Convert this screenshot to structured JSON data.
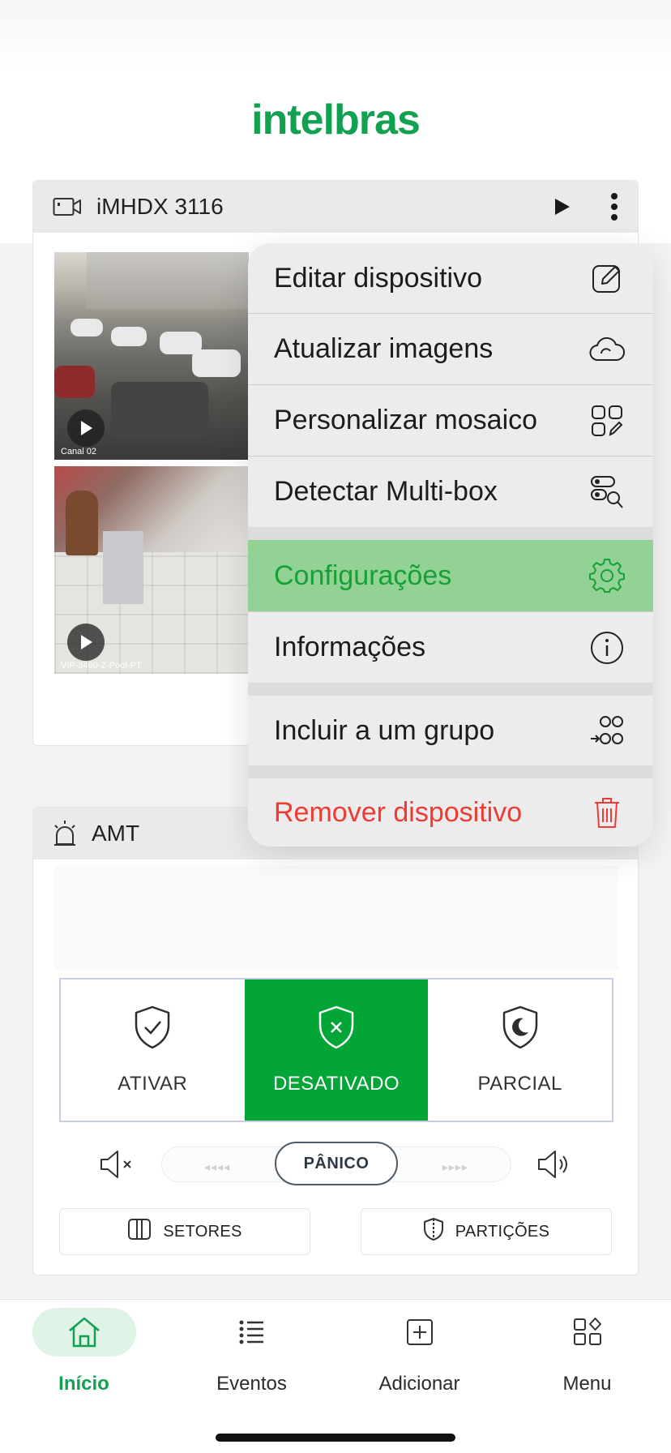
{
  "brand": {
    "logo_text": "intelbras",
    "color": "#12a150"
  },
  "camera_card": {
    "title": "iMHDX 3116",
    "thumbs": [
      {
        "caption": "Canal 02"
      },
      {
        "caption": "VIP-3460-Z-Pool-PT"
      }
    ]
  },
  "context_menu": {
    "items": [
      {
        "label": "Editar dispositivo",
        "icon": "edit-icon"
      },
      {
        "label": "Atualizar imagens",
        "icon": "cloud-refresh-icon"
      },
      {
        "label": "Personalizar mosaico",
        "icon": "mosaic-icon"
      },
      {
        "label": "Detectar Multi-box",
        "icon": "detect-search-icon"
      },
      {
        "label": "Configurações",
        "icon": "gear-icon",
        "highlighted": true
      },
      {
        "label": "Informações",
        "icon": "info-icon"
      },
      {
        "label": "Incluir a um grupo",
        "icon": "group-add-icon"
      },
      {
        "label": "Remover dispositivo",
        "icon": "trash-icon",
        "destructive": true
      }
    ]
  },
  "amt_card": {
    "title": "AMT",
    "modes": [
      {
        "label": "ATIVAR",
        "icon": "shield-check-icon"
      },
      {
        "label": "DESATIVADO",
        "icon": "shield-x-icon",
        "active": true
      },
      {
        "label": "PARCIAL",
        "icon": "shield-moon-icon"
      }
    ],
    "panic_label": "PÂNICO",
    "sectors_label": "SETORES",
    "partitions_label": "PARTIÇÕES"
  },
  "bottom_nav": [
    {
      "label": "Início",
      "icon": "home-icon",
      "active": true
    },
    {
      "label": "Eventos",
      "icon": "list-icon"
    },
    {
      "label": "Adicionar",
      "icon": "add-square-icon"
    },
    {
      "label": "Menu",
      "icon": "grid-menu-icon"
    }
  ],
  "colors": {
    "accent_green": "#04a537",
    "highlight_green": "#92d295",
    "danger_red": "#ee3b33"
  }
}
